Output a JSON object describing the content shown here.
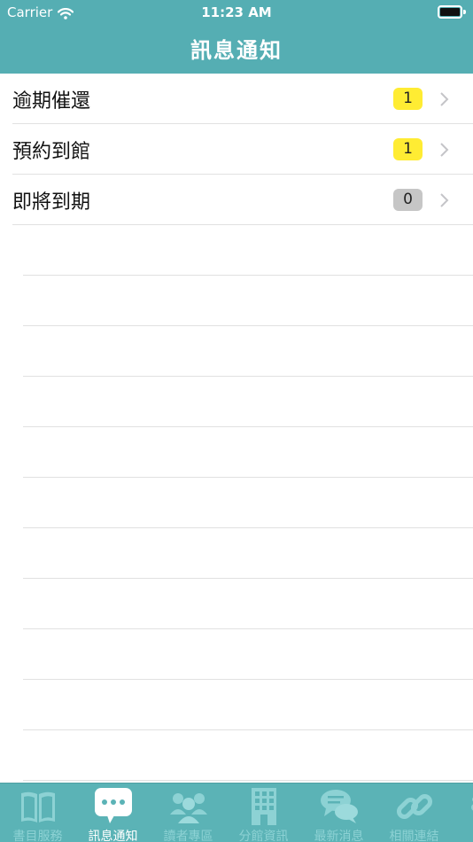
{
  "status_bar": {
    "carrier": "Carrier",
    "time": "11:23 AM"
  },
  "nav": {
    "title": "訊息通知"
  },
  "list": {
    "items": [
      {
        "label": "逾期催還",
        "count": "1",
        "badge_color": "#ffec33"
      },
      {
        "label": "預約到館",
        "count": "1",
        "badge_color": "#ffec33"
      },
      {
        "label": "即將到期",
        "count": "0",
        "badge_color": "#c6c6c6"
      }
    ]
  },
  "tabbar": {
    "background": "#5bb3b6",
    "active_index": 1,
    "tabs": [
      {
        "label": "書目服務",
        "icon": "book-icon"
      },
      {
        "label": "訊息通知",
        "icon": "chat-bubble-icon"
      },
      {
        "label": "讀者專區",
        "icon": "people-icon"
      },
      {
        "label": "分館資訊",
        "icon": "building-icon"
      },
      {
        "label": "最新消息",
        "icon": "speech-bubbles-icon"
      },
      {
        "label": "相關連結",
        "icon": "link-icon"
      }
    ]
  }
}
